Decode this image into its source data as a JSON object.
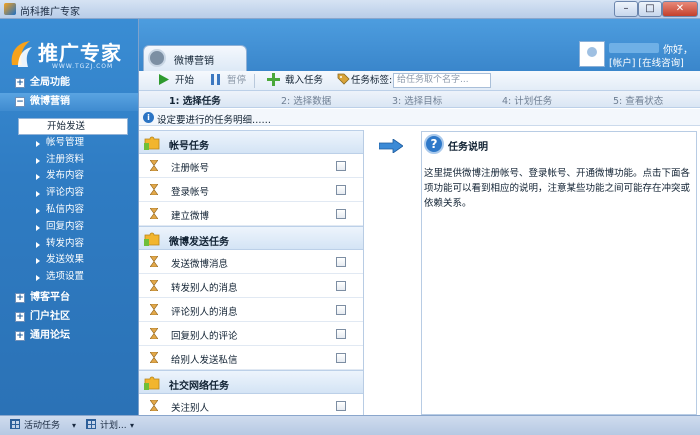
{
  "window": {
    "title": "尚科推广专家",
    "min_label": "–",
    "max_label": "□",
    "close_label": "✕"
  },
  "logo": {
    "name": "推广专家",
    "url": "WWW.TGZJ.COM"
  },
  "sidebar": {
    "sections": [
      {
        "label": "全局功能",
        "expanded": false
      },
      {
        "label": "微博营销",
        "expanded": true
      },
      {
        "label": "博客平台",
        "expanded": false
      },
      {
        "label": "门户社区",
        "expanded": false
      },
      {
        "label": "通用论坛",
        "expanded": false
      }
    ],
    "items": [
      "开始发送",
      "帐号管理",
      "注册资料",
      "发布内容",
      "评论内容",
      "私信内容",
      "回复内容",
      "转发内容",
      "发送效果",
      "选项设置"
    ]
  },
  "header": {
    "tab_label": "微博营销",
    "user": {
      "greeting": "你好，",
      "links": "[帐户] [在线咨询]"
    }
  },
  "toolbar": {
    "start": "开始",
    "pause": "暂停",
    "load_task": "载入任务",
    "task_tag_label": "任务标签:",
    "task_tag_placeholder": "给任务取个名字..."
  },
  "steps": [
    "1: 选择任务",
    "2: 选择数据",
    "3: 选择目标",
    "4: 计划任务",
    "5: 查看状态"
  ],
  "hint": "设定要进行的任务明细……",
  "task_groups": [
    {
      "label": "帐号任务",
      "tasks": [
        "注册帐号",
        "登录帐号",
        "建立微博"
      ]
    },
    {
      "label": "微博发送任务",
      "tasks": [
        "发送微博消息",
        "转发别人的消息",
        "评论别人的消息",
        "回复别人的评论",
        "给别人发送私信"
      ]
    },
    {
      "label": "社交网络任务",
      "tasks": [
        "关注别人"
      ]
    }
  ],
  "description": {
    "title": "任务说明",
    "body": "这里提供微博注册帐号、登录帐号、开通微博功能。点击下面各项功能可以看到相应的说明，注意某些功能之间可能存在冲突或依赖关系。"
  },
  "statusbar": {
    "active_tasks": "活动任务",
    "plans": "计划..."
  },
  "colors": {
    "sidebar": "#2f7cc3",
    "header": "#3a86cb",
    "accent_orange": "#f7a21b",
    "close_red": "#c3402c"
  },
  "icons": {
    "start": "play-icon",
    "pause": "pause-icon",
    "load": "plus-icon",
    "tag": "tag-icon",
    "info": "info-icon",
    "help": "question-icon",
    "task": "hourglass-icon",
    "group": "puzzle-icon"
  }
}
